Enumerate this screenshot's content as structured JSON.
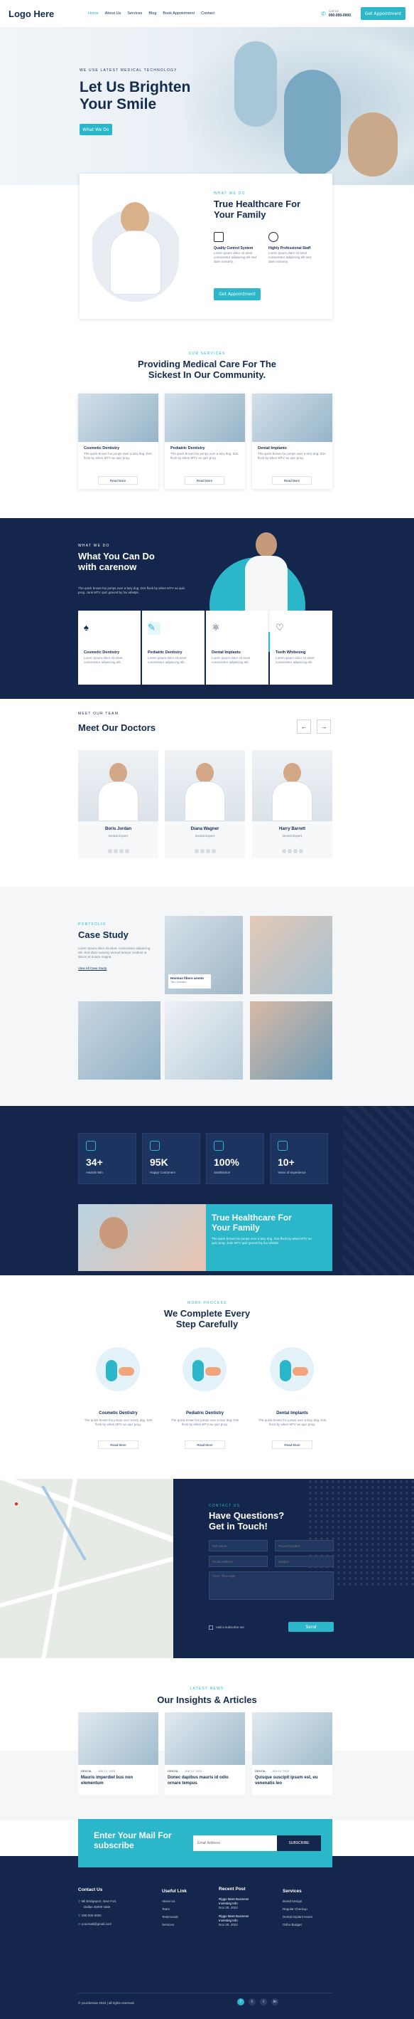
{
  "header": {
    "logo": "Logo Here",
    "nav": [
      "Home",
      "About Us",
      "Services",
      "Blog",
      "Book Appointment",
      "Contact"
    ],
    "call_label": "Call Us",
    "phone": "000-000-0000",
    "cta": "Get Appointment"
  },
  "hero": {
    "kicker": "WE USE LATEST MEDICAL TECHNOLOGY",
    "title_1": "Let Us Brighten",
    "title_2": "Your Smile",
    "button": "What We Do"
  },
  "about": {
    "kicker": "WHAT WE DO",
    "title": "True Healthcare For Your Family",
    "body": "The quick brown fox jumps over a lazy dog. Grumpy wizards make toxic brew for the evil queen.",
    "f1_title": "Quality Control System",
    "f1_body": "Lorem ipsum dolor sit amet consectetur adipiscing elit sed diam nonumy.",
    "f2_title": "Highly Professional Staff",
    "f2_body": "Lorem ipsum dolor sit amet consectetur adipiscing elit sed diam nonumy.",
    "button": "Get Appointment"
  },
  "care": {
    "kicker": "OUR SERVICES",
    "title_1": "Providing Medical Care For The",
    "title_2": "Sickest In Our Community.",
    "cards": [
      {
        "title": "Cosmetic Dentistry",
        "body": "The quick brown fox jumps over a lazy dog. DJs flock by when MTV ax quiz prog.",
        "link": "Read More"
      },
      {
        "title": "Pediatric Dentistry",
        "body": "The quick brown fox jumps over a lazy dog. DJs flock by when MTV ax quiz prog.",
        "link": "Read More"
      },
      {
        "title": "Dental Implants",
        "body": "The quick brown fox jumps over a lazy dog. DJs flock by when MTV ax quiz prog.",
        "link": "Read More"
      }
    ]
  },
  "whatdo": {
    "kicker": "WHAT WE DO",
    "title_1": "What You Can Do",
    "title_2": "with carenow",
    "body": "The quick brown fox jumps over a lazy dog. DJs flock by when MTV ax quiz prog. Junk MTV quiz graced by fox whelps.",
    "items": [
      {
        "title": "Cosmetic Dentistry",
        "body": "Lorem ipsum dolor sit amet consectetur adipiscing elit."
      },
      {
        "title": "Pediatric Dentistry",
        "body": "Lorem ipsum dolor sit amet consectetur adipiscing elit."
      },
      {
        "title": "Dental Implants",
        "body": "Lorem ipsum dolor sit amet consectetur adipiscing elit."
      },
      {
        "title": "Teeth Whitening",
        "body": "Lorem ipsum dolor sit amet consectetur adipiscing elit."
      }
    ]
  },
  "team": {
    "kicker": "MEET OUR TEAM",
    "title": "Meet Our Doctors",
    "doctors": [
      {
        "name": "Boris Jordan",
        "role": "Dental Expert"
      },
      {
        "name": "Diana Wagner",
        "role": "Dental Expert"
      },
      {
        "name": "Harry Barrett",
        "role": "Dental Expert"
      }
    ]
  },
  "case": {
    "kicker": "PORTFOLIO",
    "title": "Case Study",
    "body": "Lorem ipsum dolor sit amet, consectetur adipiscing elit. Sed diam nonumy eirmod tempor invidunt ut labore et dolore magna.",
    "link": "View All Case Study",
    "caption_title": "Hovinus fiboro aronto",
    "caption_sub": "Tem velintpe"
  },
  "stats": [
    {
      "value": "34+",
      "label": "Awards Win"
    },
    {
      "value": "95K",
      "label": "Happy Customers"
    },
    {
      "value": "100%",
      "label": "Satisfaction"
    },
    {
      "value": "10+",
      "label": "Years of experience"
    }
  ],
  "banner": {
    "title_1": "True Healthcare For",
    "title_2": "Your Family",
    "body": "The quick brown fox jumps over a lazy dog. DJs flock by when MTV ax quiz prog. Junk MTV quiz graced by fox whelps."
  },
  "steps": {
    "kicker": "WORK PROCESS",
    "title_1": "We Complete Every",
    "title_2": "Step Carefully",
    "items": [
      {
        "title": "Cosmetic Dentistry",
        "body": "The quick brown fox jumps over a lazy dog. DJs flock by when MTV ax quiz prog.",
        "link": "Read More"
      },
      {
        "title": "Pediatric Dentistry",
        "body": "The quick brown fox jumps over a lazy dog. DJs flock by when MTV ax quiz prog.",
        "link": "Read More"
      },
      {
        "title": "Dental Implants",
        "body": "The quick brown fox jumps over a lazy dog. DJs flock by when MTV ax quiz prog.",
        "link": "Read More"
      }
    ]
  },
  "contact": {
    "kicker": "CONTACT US",
    "title_1": "Have Questions?",
    "title_2": "Get in Touch!",
    "full_name": "Full Name",
    "phone": "Phone Number",
    "email": "Email Address",
    "subject": "Subject",
    "message": "Your Message",
    "check": "Add a subscribe me",
    "send": "Send"
  },
  "insights": {
    "kicker": "LATEST NEWS",
    "title": "Our Insights & Articles",
    "posts": [
      {
        "tag": "DENTAL",
        "date": "JAN 12, 2023",
        "title": "Mauris imperdiet bus non elementum"
      },
      {
        "tag": "DENTAL",
        "date": "JAN 12, 2023",
        "title": "Donec dapibus mauris id odio ornare tempus"
      },
      {
        "tag": "DENTAL",
        "date": "JAN 12, 2023",
        "title": "Quisque suscipit ipsum est, eu venenatis leo"
      }
    ]
  },
  "newsletter": {
    "title_1": "Enter Your Mail For",
    "title_2": "subscribe",
    "placeholder": "Email Address",
    "button": "SUBSCRIBE"
  },
  "footer": {
    "col1_title": "Contact Us",
    "address_1": "Mil Bridgeport, New Fort,",
    "address_2": "Dallas 45000 state",
    "phone": "000 000 0000",
    "email": "yourmail@gmail.com",
    "col2_title": "Useful Link",
    "links": [
      "About Us",
      "Team",
      "Testimonial",
      "Services"
    ],
    "col3_title": "Recent Post",
    "posts": [
      {
        "title": "Riggs Meet Business Investing Info",
        "date": "Nov 20, 2022"
      },
      {
        "title": "Riggs Meet Business Investing Info",
        "date": "Nov 20, 2022"
      }
    ],
    "col4_title": "Services",
    "services": [
      "Brand Design",
      "Regular Checkup",
      "Dental Implant Hover",
      "Ortho Budget"
    ],
    "copyright": "© yourdomain 2023 | all rights reserved"
  },
  "colors": {
    "navy": "#14264b",
    "teal": "#2bb7c9"
  }
}
